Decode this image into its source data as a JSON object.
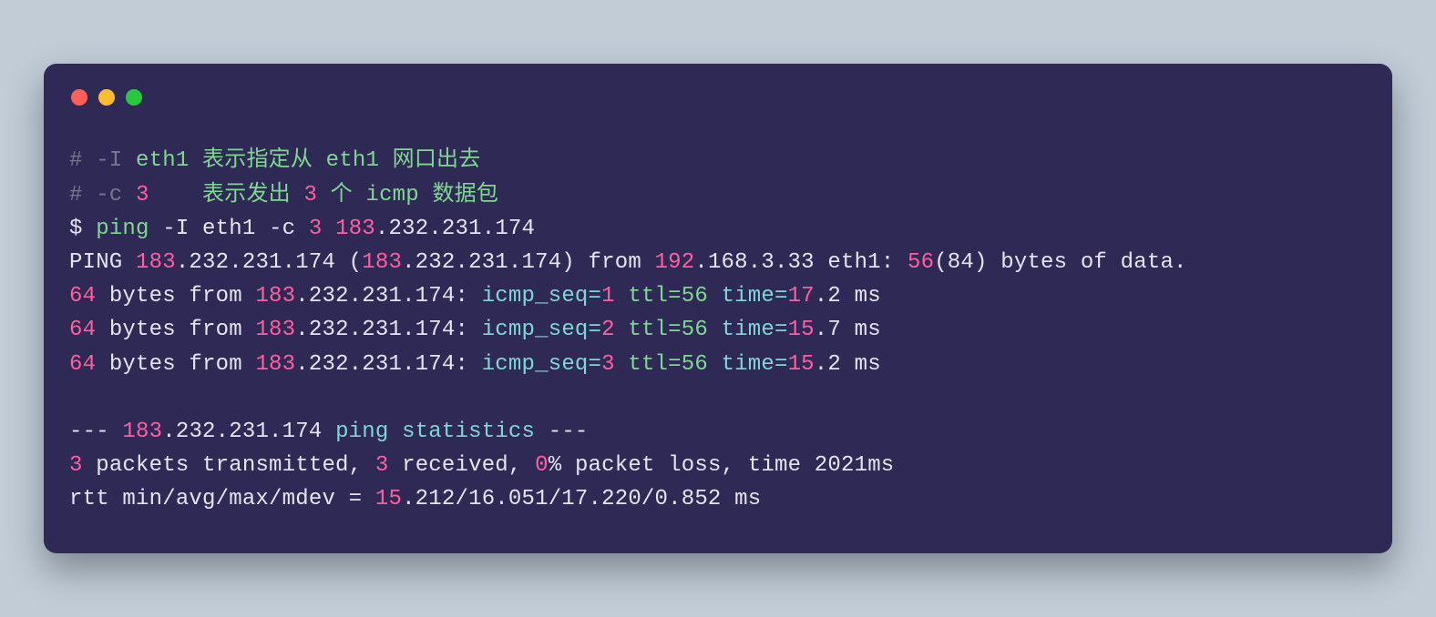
{
  "comment1": {
    "hash": "# -I ",
    "eth": "eth1",
    "rest": " 表示指定从 eth1 网口出去"
  },
  "comment2": {
    "hash": "# -c ",
    "n": "3",
    "pad": "    ",
    "a": "表示发出 ",
    "b": "3",
    "c": " 个 ",
    "d": "icmp",
    "e": " 数据包"
  },
  "cmd": {
    "prompt": "$ ",
    "ping": "ping ",
    "flagI": "-I ",
    "eth": "eth1 ",
    "flagC": "-c ",
    "n": "3 ",
    "ip1": "183",
    "ipRest": ".232.231.174"
  },
  "pingHeader": {
    "a": "PING ",
    "ip1": "183",
    "ipRest": ".232.231.174 (",
    "ip2": "183",
    "ip2Rest": ".232.231.174) from ",
    "ip3": "192",
    "ip3Rest": ".168.3.33 eth1: ",
    "sz1": "56",
    "sz2": "(84) bytes of data."
  },
  "replies": [
    {
      "bytes": "64",
      "mid": " bytes from ",
      "ip1": "183",
      "ipRest": ".232.231.174: ",
      "seqLabel": "icmp_seq=",
      "seq": "1 ",
      "ttlLabel": "ttl=56 ",
      "timeLabel": "time=",
      "t1": "17",
      "t2": ".2 ms"
    },
    {
      "bytes": "64",
      "mid": " bytes from ",
      "ip1": "183",
      "ipRest": ".232.231.174: ",
      "seqLabel": "icmp_seq=",
      "seq": "2 ",
      "ttlLabel": "ttl=56 ",
      "timeLabel": "time=",
      "t1": "15",
      "t2": ".7 ms"
    },
    {
      "bytes": "64",
      "mid": " bytes from ",
      "ip1": "183",
      "ipRest": ".232.231.174: ",
      "seqLabel": "icmp_seq=",
      "seq": "3 ",
      "ttlLabel": "ttl=56 ",
      "timeLabel": "time=",
      "t1": "15",
      "t2": ".2 ms"
    }
  ],
  "statsHeader": {
    "a": "--- ",
    "ip1": "183",
    "ipRest": ".232.231.174 ",
    "b": "ping statistics ",
    "c": "---"
  },
  "statsLine": {
    "n1": "3",
    "a": " packets transmitted, ",
    "n2": "3",
    "b": " received, ",
    "n3": "0",
    "c": "% packet loss, time 2021ms"
  },
  "rttLine": {
    "a": "rtt min/avg/max/mdev = ",
    "n1": "15",
    "b": ".212/16.051/17.220/0.852 ms"
  }
}
